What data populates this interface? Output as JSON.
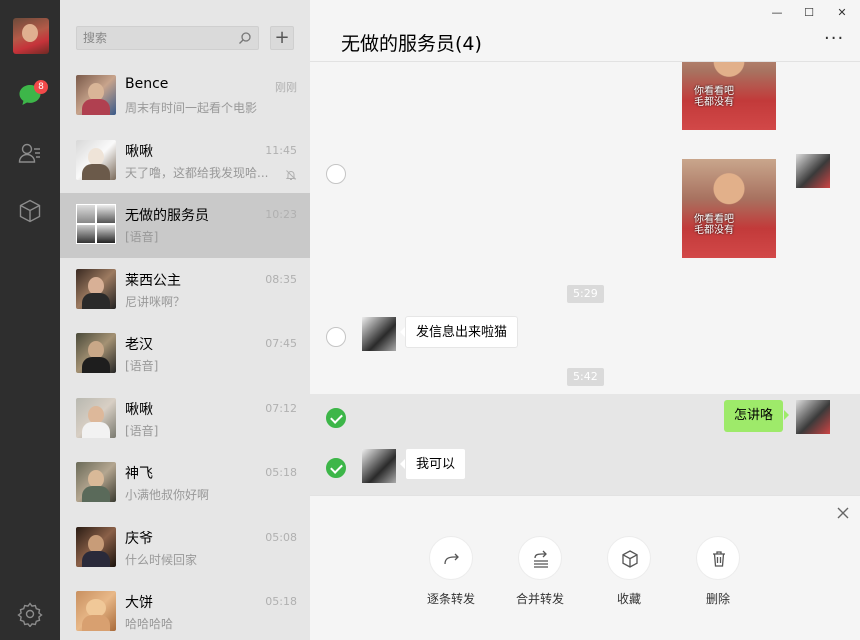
{
  "window": {
    "controls": [
      "—",
      "☐",
      "✕"
    ]
  },
  "rail": {
    "badge_count": "8",
    "icons": [
      "chat-icon",
      "contacts-icon",
      "favorites-icon",
      "settings-icon"
    ]
  },
  "search": {
    "placeholder": "搜索",
    "add_label": "+"
  },
  "conversations": [
    {
      "name": "Bence",
      "preview": "周末有时间一起看个电影",
      "time": "刚刚"
    },
    {
      "name": "啾啾",
      "preview": "天了噜，这都给我发现哈...",
      "time": "11:45",
      "muted": true
    },
    {
      "name": "无做的服务员",
      "preview": "[语音]",
      "time": "10:23",
      "active": true
    },
    {
      "name": "莱西公主",
      "preview": "尼讲咪啊？",
      "time": "08:35"
    },
    {
      "name": "老汉",
      "preview": "[语音]",
      "time": "07:45"
    },
    {
      "name": "啾啾",
      "preview": "[语音]",
      "time": "07:12"
    },
    {
      "name": "神飞",
      "preview": "小满他叔你好啊",
      "time": "05:18"
    },
    {
      "name": "庆爷",
      "preview": "什么时候回家",
      "time": "05:08"
    },
    {
      "name": "大饼",
      "preview": "哈哈哈哈",
      "time": "05:18"
    }
  ],
  "chat": {
    "title": "无做的服务员(4)",
    "more_label": "···",
    "sticker_caption_1": "你看看吧",
    "sticker_caption_2": "毛都没有",
    "times": [
      "5:29",
      "5:42"
    ],
    "messages": {
      "m1": "发信息出来啦猫",
      "m2": "怎讲咯",
      "m3": "我可以"
    }
  },
  "actions": [
    {
      "label": "逐条转发",
      "icon": "forward-icon"
    },
    {
      "label": "合并转发",
      "icon": "merge-forward-icon"
    },
    {
      "label": "收藏",
      "icon": "favorite-box-icon"
    },
    {
      "label": "删除",
      "icon": "trash-icon"
    }
  ],
  "colors": {
    "accent_green": "#3db649",
    "bubble_green": "#9eea6a",
    "badge_red": "#f14a4a"
  }
}
